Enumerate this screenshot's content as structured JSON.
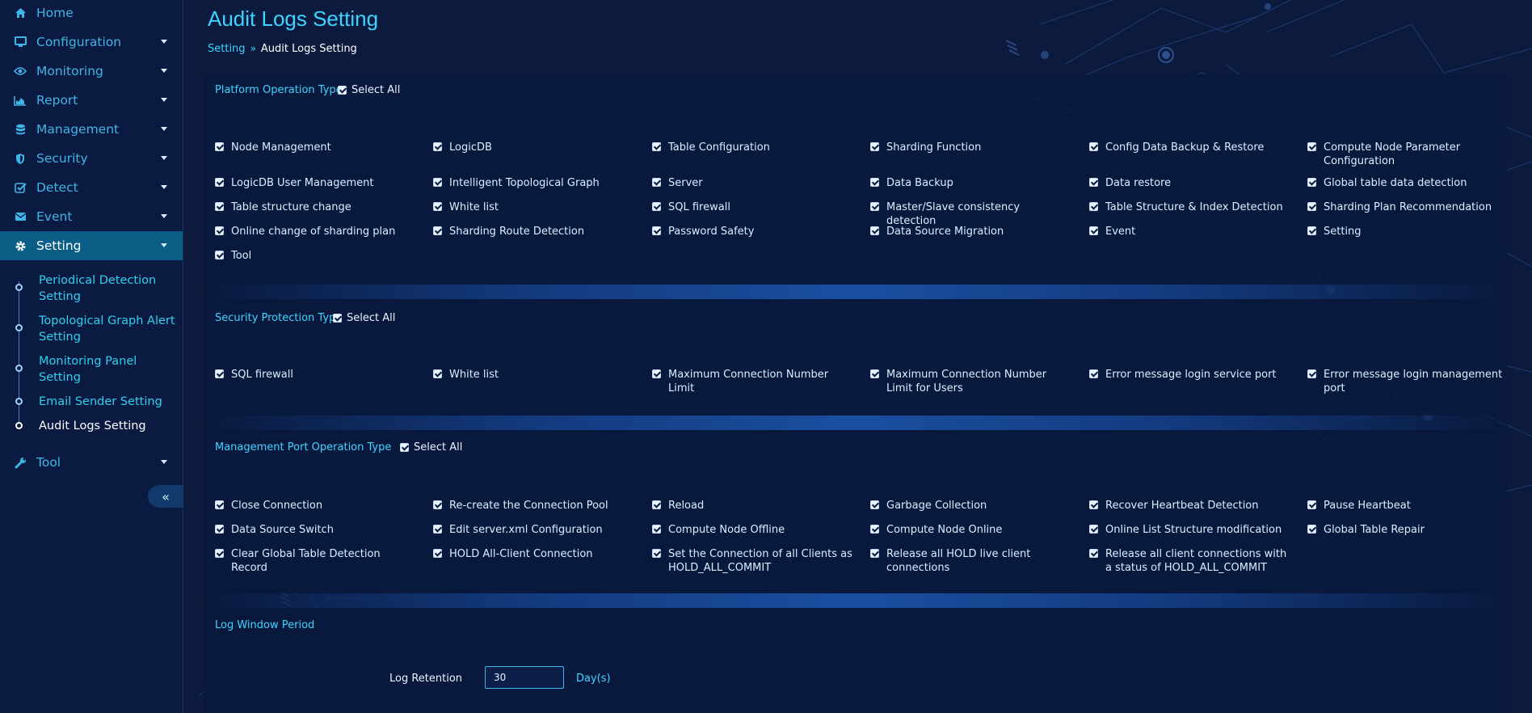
{
  "sidebar": {
    "nav": [
      {
        "label": "Home",
        "icon": "home-icon",
        "has_caret": false
      },
      {
        "label": "Configuration",
        "icon": "monitor-icon",
        "has_caret": true
      },
      {
        "label": "Monitoring",
        "icon": "eye-icon",
        "has_caret": true
      },
      {
        "label": "Report",
        "icon": "area-chart-icon",
        "has_caret": true
      },
      {
        "label": "Management",
        "icon": "database-icon",
        "has_caret": true
      },
      {
        "label": "Security",
        "icon": "shield-icon",
        "has_caret": true
      },
      {
        "label": "Detect",
        "icon": "check-square-icon",
        "has_caret": true
      },
      {
        "label": "Event",
        "icon": "envelope-icon",
        "has_caret": true
      },
      {
        "label": "Setting",
        "icon": "gear-icon",
        "has_caret": true,
        "active": true
      }
    ],
    "sub_items": [
      {
        "label": "Periodical Detection Setting"
      },
      {
        "label": "Topological Graph Alert Setting"
      },
      {
        "label": "Monitoring Panel Setting"
      },
      {
        "label": "Email Sender Setting"
      },
      {
        "label": "Audit Logs Setting",
        "current": true
      }
    ],
    "tool": {
      "label": "Tool",
      "icon": "wrench-icon"
    },
    "collapse_glyph": "«"
  },
  "header": {
    "title": "Audit Logs Setting",
    "breadcrumb": {
      "parent": "Setting",
      "separator": "»",
      "current": "Audit Logs Setting"
    }
  },
  "sections": {
    "platform": {
      "title": "Platform Operation Type",
      "select_all": "Select All",
      "options": [
        "Node Management",
        "LogicDB",
        "Table Configuration",
        "Sharding Function",
        "Config Data Backup & Restore",
        "Compute Node Parameter Configuration",
        "LogicDB User Management",
        "Intelligent Topological Graph",
        "Server",
        "Data Backup",
        "Data restore",
        "Global table data detection",
        "Table structure change",
        "White list",
        "SQL firewall",
        "Master/Slave consistency detection",
        "Table Structure & Index Detection",
        "Sharding Plan Recommendation",
        "Online change of sharding plan",
        "Sharding Route Detection",
        "Password Safety",
        "Data Source Migration",
        "Event",
        "Setting",
        "Tool"
      ]
    },
    "security": {
      "title": "Security Protection Type",
      "select_all": "Select All",
      "options": [
        "SQL firewall",
        "White list",
        "Maximum Connection Number Limit",
        "Maximum Connection Number Limit for Users",
        "Error message login service port",
        "Error message login management port"
      ]
    },
    "management": {
      "title": "Management Port Operation Type",
      "select_all": "Select All",
      "options": [
        "Close Connection",
        "Re-create the Connection Pool",
        "Reload",
        "Garbage Collection",
        "Recover Heartbeat Detection",
        "Pause Heartbeat",
        "Data Source Switch",
        "Edit server.xml Configuration",
        "Compute Node Offline",
        "Compute Node Online",
        "Online List Structure modification",
        "Global Table Repair",
        "Clear Global Table Detection Record",
        "HOLD All-Client Connection",
        "Set the Connection of all Clients as HOLD_ALL_COMMIT",
        "Release all HOLD live client connections",
        "Release all client connections with a status of HOLD_ALL_COMMIT"
      ]
    },
    "log_window": {
      "title": "Log Window Period",
      "retention_label": "Log Retention",
      "retention_value": "30",
      "retention_unit": "Day(s)"
    }
  },
  "colors": {
    "background": "#0b1a3d",
    "sidebar_active": "#0a5e86",
    "accent": "#3fd4ff",
    "link": "#3fb6e8"
  }
}
